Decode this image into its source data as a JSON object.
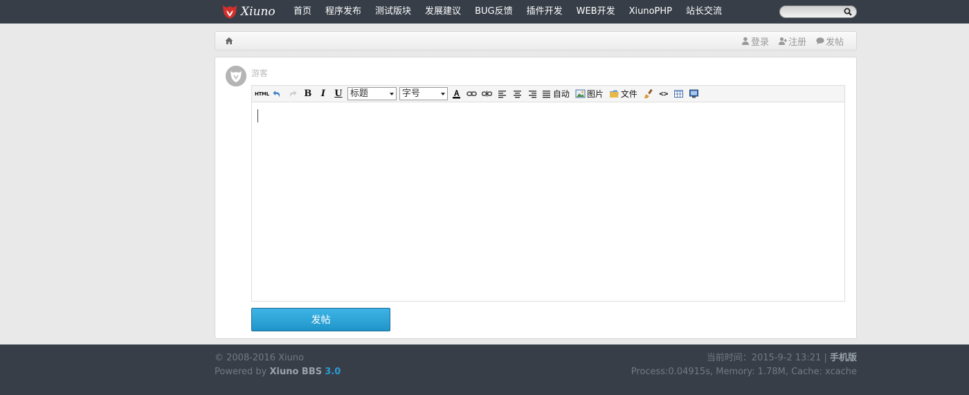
{
  "header": {
    "logo_text": "Xiuno",
    "nav": [
      {
        "label": "首页"
      },
      {
        "label": "程序发布"
      },
      {
        "label": "测试版块"
      },
      {
        "label": "发展建议"
      },
      {
        "label": "BUG反馈"
      },
      {
        "label": "插件开发"
      },
      {
        "label": "WEB开发"
      },
      {
        "label": "XiunoPHP"
      },
      {
        "label": "站长交流"
      }
    ],
    "search_value": ""
  },
  "breadcrumb": {
    "home_icon": "home-icon",
    "login": "登录",
    "register": "注册",
    "post": "发帖"
  },
  "post": {
    "user": "游客",
    "editor": {
      "html_label": "HTML",
      "bold": "B",
      "italic": "I",
      "underline": "U",
      "heading": "标题",
      "fontsize": "字号",
      "auto_label": "自动",
      "image_label": "图片",
      "file_label": "文件",
      "code_label": "<>",
      "content": ""
    },
    "submit_label": "发帖"
  },
  "footer": {
    "copyright": "© 2008-2016 Xiuno",
    "powered_prefix": "Powered by ",
    "powered_name": "Xiuno BBS",
    "version": "3.0",
    "time_label": "当前时间：2015-9-2 13:21 | ",
    "mobile": "手机版",
    "process": "Process:0.04915s, Memory: 1.78M, Cache: xcache"
  },
  "colors": {
    "topbar": "#373e48",
    "accent": "#1f94c9",
    "background": "#e9e9e9"
  }
}
